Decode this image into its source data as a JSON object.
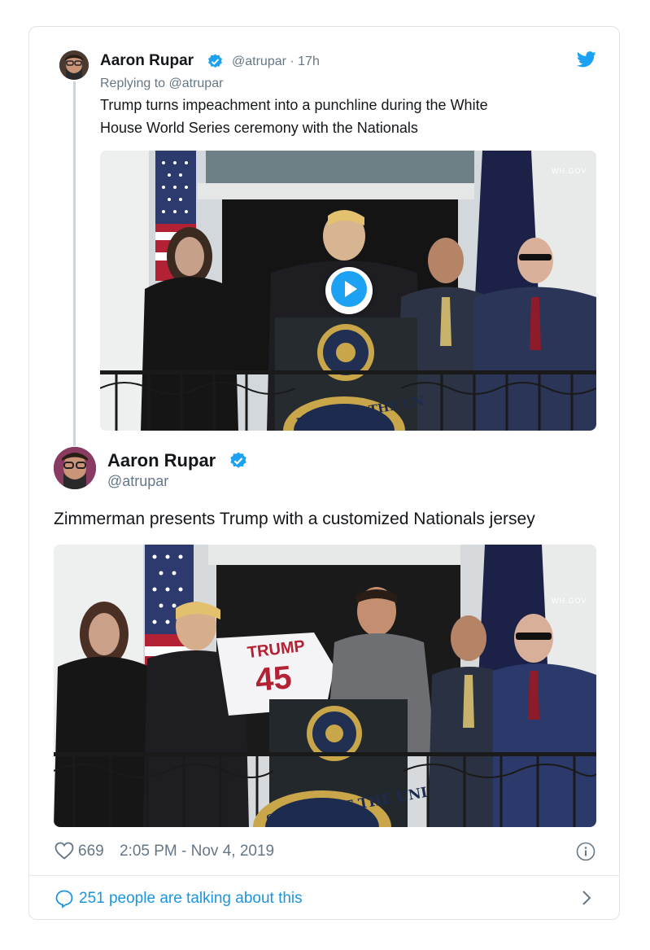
{
  "reply_tweet": {
    "author_name": "Aaron Rupar",
    "handle_time": "@atrupar · 17h",
    "replying_to": "Replying to @atrupar",
    "text_line1": "Trump turns impeachment into a punchline during the White",
    "text_line2": "House World Series ceremony with the Nationals",
    "media_watermark": "WH.GOV",
    "seal_text": "IDENT OF THE UN",
    "play_icon": "play-icon"
  },
  "main_tweet": {
    "author_name": "Aaron Rupar",
    "handle": "@atrupar",
    "text": "Zimmerman presents Trump with a customized Nationals jersey",
    "jersey_name": "TRUMP",
    "jersey_number": "45",
    "media_watermark": "WH.GOV",
    "seal_text": "SIDENT OF THE UNI"
  },
  "footer": {
    "likes": "669",
    "timestamp": "2:05 PM - Nov 4, 2019",
    "talking": "251 people are talking about this",
    "icons": [
      "heart-icon",
      "info-icon",
      "speech-bubble-icon",
      "chevron-right-icon",
      "twitter-bird-icon",
      "verified-badge-icon"
    ]
  },
  "colors": {
    "twitter_blue": "#1da1f2",
    "link_blue": "#1b95e0",
    "muted": "#657786",
    "border": "#e1e8ed"
  }
}
